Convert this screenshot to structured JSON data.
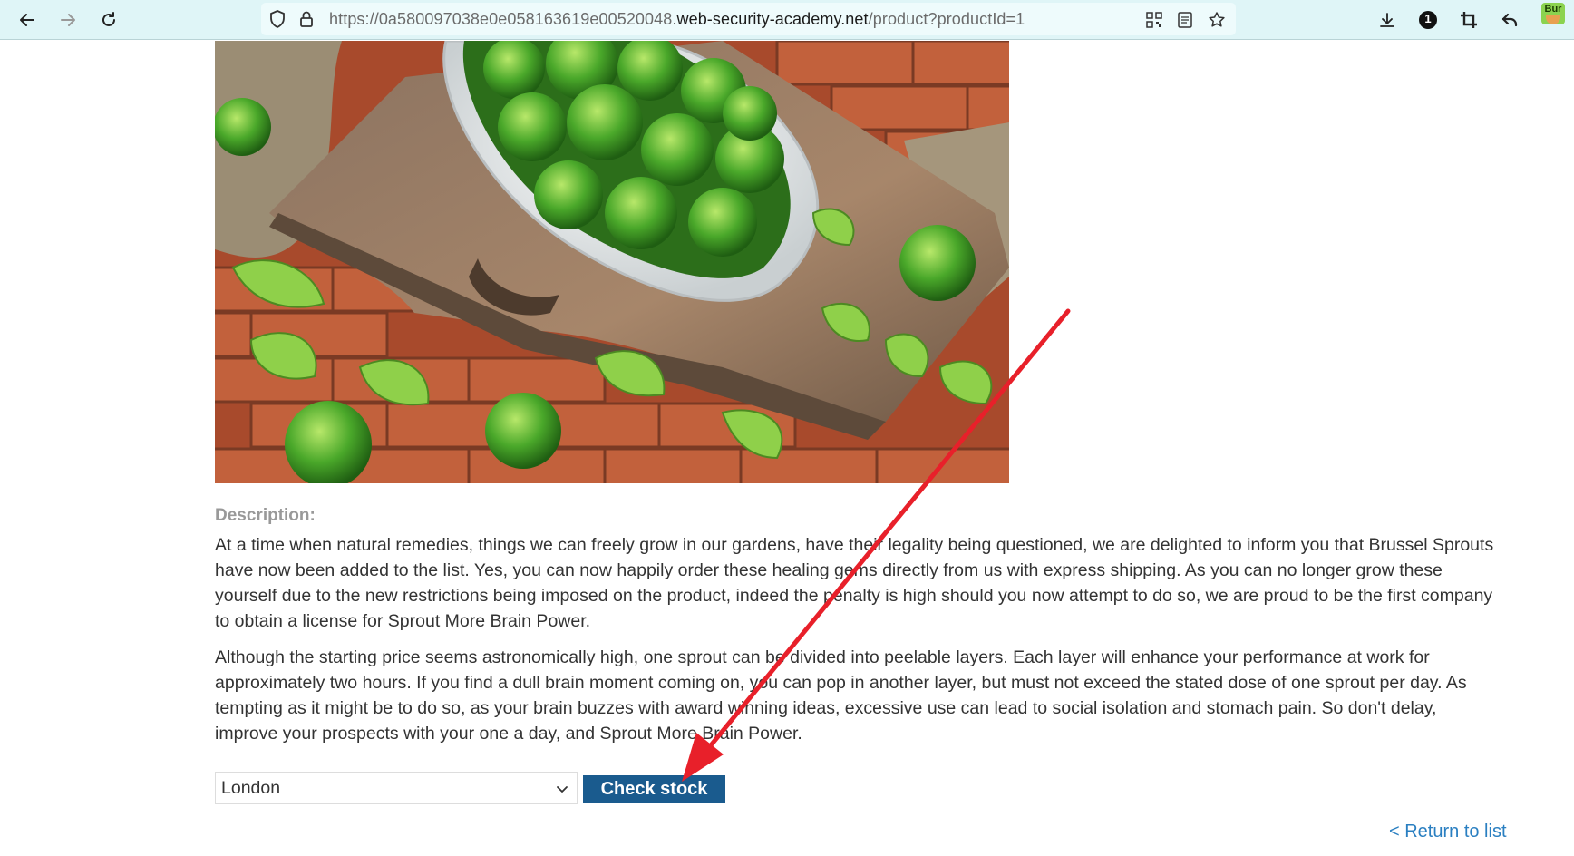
{
  "browser": {
    "url_prefix": "https://0a580097038e0e058163619e00520048.",
    "url_domain": "web-security-academy.net",
    "url_path": "/product?productId=1",
    "extension_badge_text": "Bur",
    "icons": {
      "back": "arrow-left-icon",
      "forward": "arrow-right-icon",
      "reload": "reload-icon",
      "shield": "shield-icon",
      "lock": "lock-icon",
      "qr": "qr-code-icon",
      "reader": "reader-view-icon",
      "star": "bookmark-star-icon",
      "download": "download-icon",
      "badge": "notification-badge-icon",
      "crop": "crop-icon",
      "undo": "undo-arrow-icon"
    },
    "notification_count": "1"
  },
  "product": {
    "image_alt": "Bowl of Brussels sprouts on a wooden board over brick",
    "description_heading": "Description:",
    "description_paragraph_1": "At a time when natural remedies, things we can freely grow in our gardens, have their legality being questioned, we are delighted to inform you that Brussel Sprouts have now been added to the list. Yes, you can now happily order these healing gems directly from us with express shipping. As you can no longer grow these yourself due to the new restrictions being imposed on the product, indeed the penalty is high should you now attempt to do so, we are proud to be the first company to obtain a license for Sprout More Brain Power.",
    "description_paragraph_2": "Although the starting price seems astronomically high, one sprout can be divided into peelable layers. Each layer will enhance your performance at work for approximately two hours. If you find a dull brain moment coming on, you can pop in another layer, but must not exceed the stated dose of one sprout per day. As tempting as it might be to do so, as your brain buzzes with award winning ideas, excessive use can lead to social isolation and stomach pain. So don't delay, improve your prospects with your one a day, and Sprout More Brain Power."
  },
  "stock_check": {
    "store_selected": "London",
    "button_label": "Check stock"
  },
  "navigation": {
    "return_link": "< Return to list"
  },
  "colors": {
    "button_bg": "#1a5b8e",
    "link": "#2a7fc1",
    "annotation_arrow": "#e8202a",
    "toolbar_bg": "#dff5f7"
  }
}
